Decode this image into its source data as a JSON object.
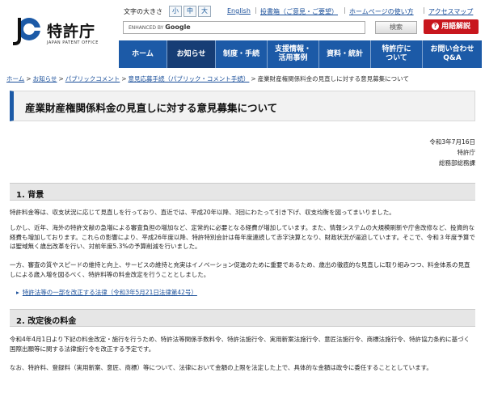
{
  "header": {
    "logo_name": "特許庁",
    "logo_sub": "JAPAN PATENT OFFICE",
    "fontsize_label": "文字の大きさ",
    "fontsize_options": [
      "小",
      "中",
      "大"
    ],
    "links": [
      "English",
      "投書箱（ご意見・ご要望）",
      "ホームページの使い方",
      "アクセスマップ"
    ],
    "search_enhanced": "ENHANCED BY",
    "search_google": "Google",
    "search_button": "検索",
    "glossary_label": "用語解説"
  },
  "nav": {
    "items": [
      "ホーム",
      "お知らせ",
      "制度・手続",
      "支援情報・\n活用事例",
      "資料・統計",
      "特許庁に\nついて",
      "お問い合わせ\nQ&A"
    ]
  },
  "breadcrumb": {
    "items": [
      "ホーム",
      "お知らせ",
      "パブリックコメント",
      "意見応募手続（パブリック・コメント手続）"
    ],
    "current": "産業財産権関係料金の見直しに対する意見募集について"
  },
  "page": {
    "title": "産業財産権関係料金の見直しに対する意見募集について",
    "date": "令和3年7月16日",
    "org": "特許庁",
    "dept": "総務部総務課"
  },
  "sections": {
    "s1_title": "1. 背景",
    "s1_p1": "特許料金等は、収支状況に応じて見直しを行っており、直近では、平成20年以降、3回にわたって引き下げ、収支均衡を図ってまいりました。",
    "s1_p2": "しかし、近年、海外の特許文献の急増による審査負担の増加など、定常的に必要となる経費が増加しています。また、情報システムの大規模刷新や庁舎改修など、投資的な経費も増加しております。これらの影響により、平成26年度以降、特許特別会計は毎年度連続して赤字決算となり、財政状況が逼迫しています。そこで、令和３年度予算では聖域無く歳出改革を行い、対前年度5.3%の予算削減を行いました。",
    "s1_p3": "一方、審査の質やスピードの維持と向上、サービスの維持と充実はイノベーション促進のために重要であるため、歳出の徹底的な見直しに取り組みつつ、料金体系の見直しによる歳入増を図るべく、特許料等の料金改定を行うこととしました。",
    "s1_link": "特許法等の一部を改正する法律（令和3年5月21日法律第42号）",
    "s2_title": "2. 改定後の料金",
    "s2_p1": "令和4年4月1日より下記の料金改定・施行を行うため、特許法等関係手数料令、特許法施行令、実用新案法施行令、意匠法施行令、商標法施行令、特許協力条約に基づく国際出願等に関する法律施行令を改正する予定です。",
    "s2_p2": "なお、特許料、登録料（実用新案、意匠、商標）等について、法律において金額の上限を法定した上で、具体的な金額は政令に委任することとしています。"
  },
  "colors": {
    "nav_blue": "#1c5aa7",
    "nav_active": "#163d75",
    "glossary_red": "#c8161d",
    "link_blue": "#1a4f9a"
  }
}
